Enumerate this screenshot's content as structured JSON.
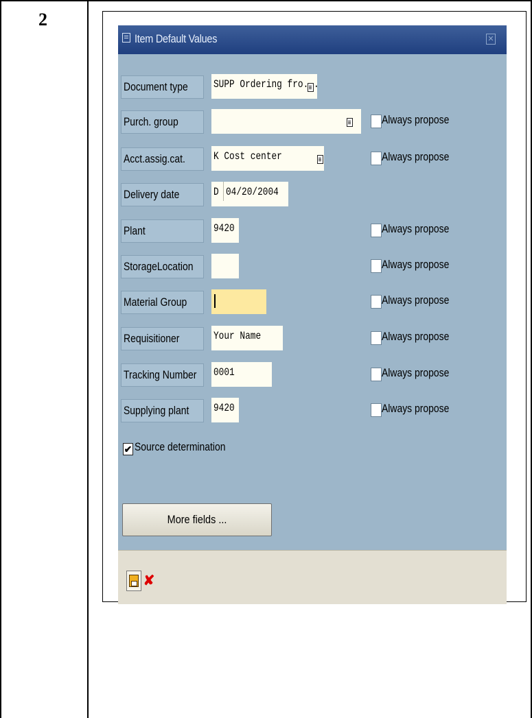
{
  "step": {
    "number": "2"
  },
  "dialog": {
    "title": "Item Default Values",
    "fields": [
      {
        "label": "Document type",
        "value": "SUPP Ordering fro... ",
        "dropdown": true,
        "always_propose": null
      },
      {
        "label": "Purch. group",
        "value": "",
        "dropdown": true,
        "always_propose": "Always propose"
      },
      {
        "label": "Acct.assig.cat.",
        "value": "K Cost center",
        "dropdown": true,
        "always_propose": "Always propose"
      },
      {
        "label": "Delivery date",
        "prefix": "D",
        "value": "04/20/2004",
        "always_propose": null
      },
      {
        "label": "Plant",
        "value": "9420",
        "always_propose": "Always propose"
      },
      {
        "label": "StorageLocation",
        "value": "",
        "always_propose": "Always propose"
      },
      {
        "label": "Material Group",
        "value": "",
        "active": true,
        "always_propose": "Always propose"
      },
      {
        "label": "Requisitioner",
        "value": "Your Name",
        "always_propose": "Always propose"
      },
      {
        "label": "Tracking Number",
        "value": "0001",
        "always_propose": "Always propose"
      },
      {
        "label": "Supplying plant",
        "value": "9420",
        "always_propose": "Always propose"
      }
    ],
    "source_determination": {
      "label": "Source determination",
      "checked": true,
      "mark": "✔"
    },
    "more_fields_label": "More fields ...",
    "close_glyph": "✕",
    "cancel_glyph": "✘",
    "colors": {
      "background": "#9db6c9",
      "titlebar": "#1f3f7f",
      "input": "#fefdf1",
      "active_input": "#fde9a0",
      "footer": "#e3dfd2"
    }
  }
}
